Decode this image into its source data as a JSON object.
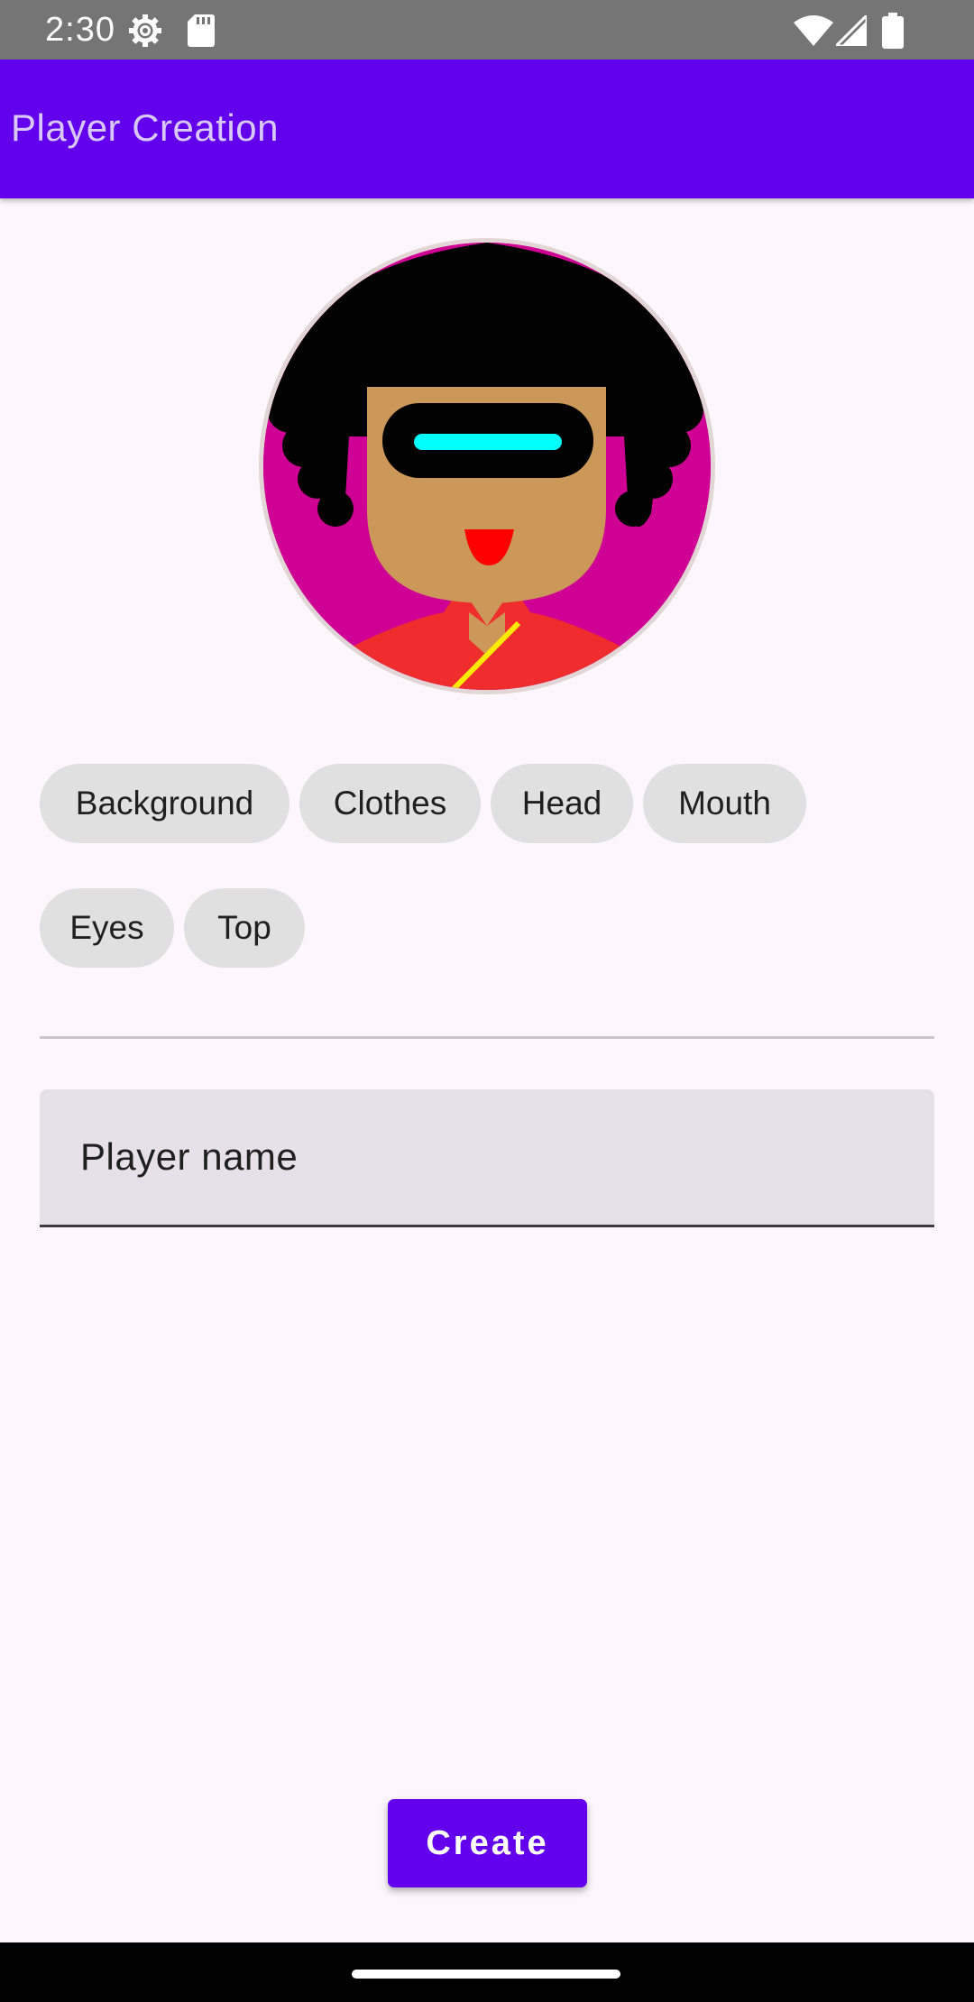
{
  "status_bar": {
    "time": "2:30",
    "icons": [
      "settings-gear-icon",
      "sd-card-icon",
      "wifi-icon",
      "cellular-signal-icon",
      "battery-icon"
    ]
  },
  "app_bar": {
    "title": "Player Creation"
  },
  "avatar": {
    "colors": {
      "background": "#CF0094",
      "hair": "#000000",
      "skin": "#CC985A",
      "visor": "#000000",
      "visor_light": "#00FFFF",
      "mouth": "#FF0000",
      "clothes": "#F02D2D",
      "clothes_stripe": "#FFEA00"
    }
  },
  "chips": [
    {
      "label": "Background"
    },
    {
      "label": "Clothes"
    },
    {
      "label": "Head"
    },
    {
      "label": "Mouth"
    },
    {
      "label": "Eyes"
    },
    {
      "label": "Top"
    }
  ],
  "name_field": {
    "label": "Player name",
    "value": ""
  },
  "create_button": {
    "label": "Create"
  },
  "colors": {
    "primary": "#6200EE",
    "page_background": "#FDF7FD",
    "chip_background": "#E0E0E0",
    "field_background": "#E6E0E9"
  }
}
